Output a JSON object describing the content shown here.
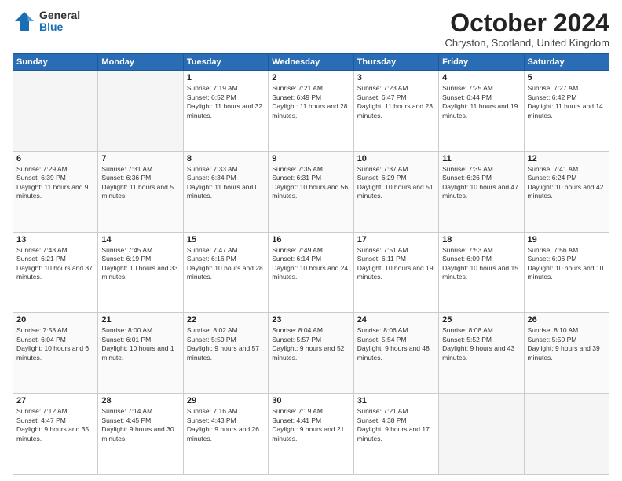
{
  "logo": {
    "general": "General",
    "blue": "Blue"
  },
  "title": "October 2024",
  "location": "Chryston, Scotland, United Kingdom",
  "days_header": [
    "Sunday",
    "Monday",
    "Tuesday",
    "Wednesday",
    "Thursday",
    "Friday",
    "Saturday"
  ],
  "weeks": [
    [
      {
        "num": "",
        "sunrise": "",
        "sunset": "",
        "daylight": "",
        "empty": true
      },
      {
        "num": "",
        "sunrise": "",
        "sunset": "",
        "daylight": "",
        "empty": true
      },
      {
        "num": "1",
        "sunrise": "Sunrise: 7:19 AM",
        "sunset": "Sunset: 6:52 PM",
        "daylight": "Daylight: 11 hours and 32 minutes."
      },
      {
        "num": "2",
        "sunrise": "Sunrise: 7:21 AM",
        "sunset": "Sunset: 6:49 PM",
        "daylight": "Daylight: 11 hours and 28 minutes."
      },
      {
        "num": "3",
        "sunrise": "Sunrise: 7:23 AM",
        "sunset": "Sunset: 6:47 PM",
        "daylight": "Daylight: 11 hours and 23 minutes."
      },
      {
        "num": "4",
        "sunrise": "Sunrise: 7:25 AM",
        "sunset": "Sunset: 6:44 PM",
        "daylight": "Daylight: 11 hours and 19 minutes."
      },
      {
        "num": "5",
        "sunrise": "Sunrise: 7:27 AM",
        "sunset": "Sunset: 6:42 PM",
        "daylight": "Daylight: 11 hours and 14 minutes."
      }
    ],
    [
      {
        "num": "6",
        "sunrise": "Sunrise: 7:29 AM",
        "sunset": "Sunset: 6:39 PM",
        "daylight": "Daylight: 11 hours and 9 minutes."
      },
      {
        "num": "7",
        "sunrise": "Sunrise: 7:31 AM",
        "sunset": "Sunset: 6:36 PM",
        "daylight": "Daylight: 11 hours and 5 minutes."
      },
      {
        "num": "8",
        "sunrise": "Sunrise: 7:33 AM",
        "sunset": "Sunset: 6:34 PM",
        "daylight": "Daylight: 11 hours and 0 minutes."
      },
      {
        "num": "9",
        "sunrise": "Sunrise: 7:35 AM",
        "sunset": "Sunset: 6:31 PM",
        "daylight": "Daylight: 10 hours and 56 minutes."
      },
      {
        "num": "10",
        "sunrise": "Sunrise: 7:37 AM",
        "sunset": "Sunset: 6:29 PM",
        "daylight": "Daylight: 10 hours and 51 minutes."
      },
      {
        "num": "11",
        "sunrise": "Sunrise: 7:39 AM",
        "sunset": "Sunset: 6:26 PM",
        "daylight": "Daylight: 10 hours and 47 minutes."
      },
      {
        "num": "12",
        "sunrise": "Sunrise: 7:41 AM",
        "sunset": "Sunset: 6:24 PM",
        "daylight": "Daylight: 10 hours and 42 minutes."
      }
    ],
    [
      {
        "num": "13",
        "sunrise": "Sunrise: 7:43 AM",
        "sunset": "Sunset: 6:21 PM",
        "daylight": "Daylight: 10 hours and 37 minutes."
      },
      {
        "num": "14",
        "sunrise": "Sunrise: 7:45 AM",
        "sunset": "Sunset: 6:19 PM",
        "daylight": "Daylight: 10 hours and 33 minutes."
      },
      {
        "num": "15",
        "sunrise": "Sunrise: 7:47 AM",
        "sunset": "Sunset: 6:16 PM",
        "daylight": "Daylight: 10 hours and 28 minutes."
      },
      {
        "num": "16",
        "sunrise": "Sunrise: 7:49 AM",
        "sunset": "Sunset: 6:14 PM",
        "daylight": "Daylight: 10 hours and 24 minutes."
      },
      {
        "num": "17",
        "sunrise": "Sunrise: 7:51 AM",
        "sunset": "Sunset: 6:11 PM",
        "daylight": "Daylight: 10 hours and 19 minutes."
      },
      {
        "num": "18",
        "sunrise": "Sunrise: 7:53 AM",
        "sunset": "Sunset: 6:09 PM",
        "daylight": "Daylight: 10 hours and 15 minutes."
      },
      {
        "num": "19",
        "sunrise": "Sunrise: 7:56 AM",
        "sunset": "Sunset: 6:06 PM",
        "daylight": "Daylight: 10 hours and 10 minutes."
      }
    ],
    [
      {
        "num": "20",
        "sunrise": "Sunrise: 7:58 AM",
        "sunset": "Sunset: 6:04 PM",
        "daylight": "Daylight: 10 hours and 6 minutes."
      },
      {
        "num": "21",
        "sunrise": "Sunrise: 8:00 AM",
        "sunset": "Sunset: 6:01 PM",
        "daylight": "Daylight: 10 hours and 1 minute."
      },
      {
        "num": "22",
        "sunrise": "Sunrise: 8:02 AM",
        "sunset": "Sunset: 5:59 PM",
        "daylight": "Daylight: 9 hours and 57 minutes."
      },
      {
        "num": "23",
        "sunrise": "Sunrise: 8:04 AM",
        "sunset": "Sunset: 5:57 PM",
        "daylight": "Daylight: 9 hours and 52 minutes."
      },
      {
        "num": "24",
        "sunrise": "Sunrise: 8:06 AM",
        "sunset": "Sunset: 5:54 PM",
        "daylight": "Daylight: 9 hours and 48 minutes."
      },
      {
        "num": "25",
        "sunrise": "Sunrise: 8:08 AM",
        "sunset": "Sunset: 5:52 PM",
        "daylight": "Daylight: 9 hours and 43 minutes."
      },
      {
        "num": "26",
        "sunrise": "Sunrise: 8:10 AM",
        "sunset": "Sunset: 5:50 PM",
        "daylight": "Daylight: 9 hours and 39 minutes."
      }
    ],
    [
      {
        "num": "27",
        "sunrise": "Sunrise: 7:12 AM",
        "sunset": "Sunset: 4:47 PM",
        "daylight": "Daylight: 9 hours and 35 minutes."
      },
      {
        "num": "28",
        "sunrise": "Sunrise: 7:14 AM",
        "sunset": "Sunset: 4:45 PM",
        "daylight": "Daylight: 9 hours and 30 minutes."
      },
      {
        "num": "29",
        "sunrise": "Sunrise: 7:16 AM",
        "sunset": "Sunset: 4:43 PM",
        "daylight": "Daylight: 9 hours and 26 minutes."
      },
      {
        "num": "30",
        "sunrise": "Sunrise: 7:19 AM",
        "sunset": "Sunset: 4:41 PM",
        "daylight": "Daylight: 9 hours and 21 minutes."
      },
      {
        "num": "31",
        "sunrise": "Sunrise: 7:21 AM",
        "sunset": "Sunset: 4:38 PM",
        "daylight": "Daylight: 9 hours and 17 minutes."
      },
      {
        "num": "",
        "sunrise": "",
        "sunset": "",
        "daylight": "",
        "empty": true
      },
      {
        "num": "",
        "sunrise": "",
        "sunset": "",
        "daylight": "",
        "empty": true
      }
    ]
  ]
}
